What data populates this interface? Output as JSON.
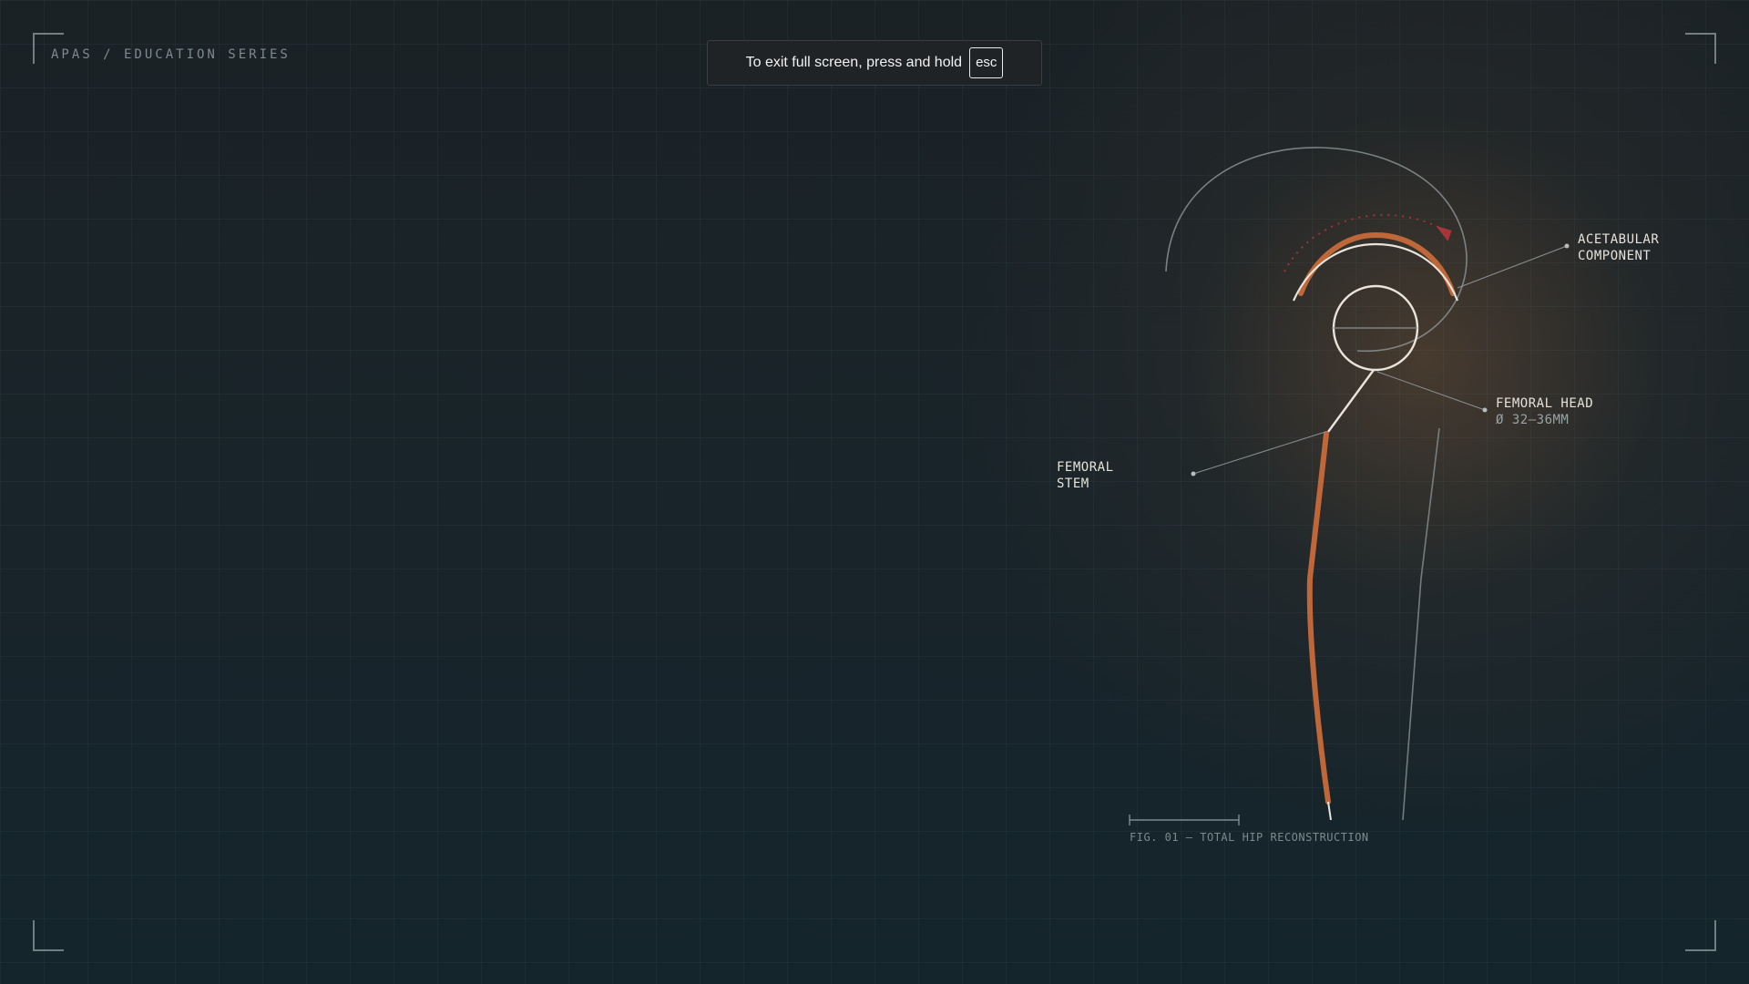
{
  "header": {
    "brand": "APAS / EDUCATION SERIES"
  },
  "fullscreen_notice": {
    "message": "To exit full screen, press and hold",
    "key": "esc"
  },
  "diagram": {
    "labels": {
      "acetabular": [
        "ACETABULAR",
        "COMPONENT"
      ],
      "femoral_head": [
        "FEMORAL HEAD",
        "Ø 32–36MM"
      ],
      "femoral_stem": [
        "FEMORAL",
        "STEM"
      ]
    },
    "caption": "FIG. 01 — TOTAL HIP RECONSTRUCTION",
    "colors": {
      "accent": "#c0673a",
      "line": "#e8e4da",
      "guide": "#8a9193",
      "arrow": "#a8353a"
    }
  }
}
